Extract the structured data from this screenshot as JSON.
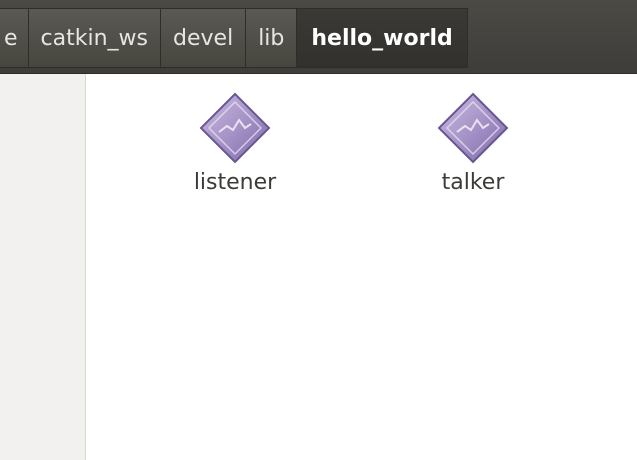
{
  "pathbar": {
    "crumbs": [
      {
        "label": "e"
      },
      {
        "label": "catkin_ws"
      },
      {
        "label": "devel"
      },
      {
        "label": "lib"
      },
      {
        "label": "hello_world",
        "active": true
      }
    ]
  },
  "files": [
    {
      "name": "listener",
      "icon": "executable-icon"
    },
    {
      "name": "talker",
      "icon": "executable-icon"
    }
  ],
  "colors": {
    "pathbar_bg": "#3e3d39",
    "icon_purple": "#a693c7"
  }
}
